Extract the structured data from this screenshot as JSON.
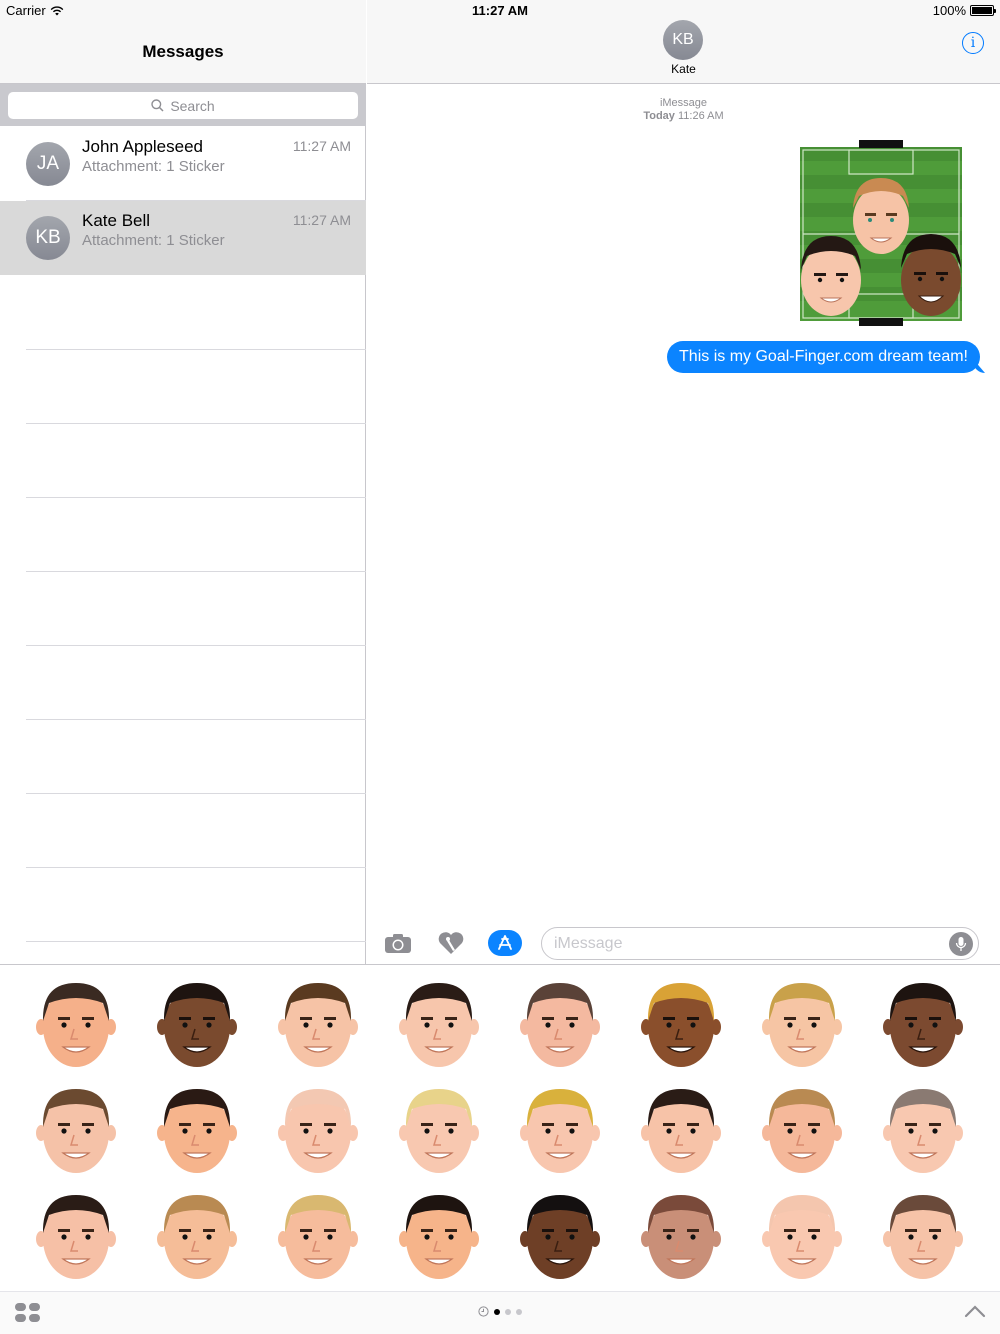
{
  "status_bar": {
    "carrier": "Carrier",
    "time": "11:27 AM",
    "battery": "100%"
  },
  "sidebar": {
    "title": "Messages",
    "search_placeholder": "Search",
    "conversations": [
      {
        "initials": "JA",
        "name": "John Appleseed",
        "preview": "Attachment: 1 Sticker",
        "time": "11:27 AM",
        "selected": false
      },
      {
        "initials": "KB",
        "name": "Kate Bell",
        "preview": "Attachment: 1 Sticker",
        "time": "11:27 AM",
        "selected": true
      }
    ]
  },
  "conversation": {
    "contact_initials": "KB",
    "contact_name": "Kate",
    "service": "iMessage",
    "day": "Today",
    "time": "11:26 AM",
    "message": "This is my Goal-Finger.com dream team!",
    "bubble_color": "#0b84ff",
    "composer_placeholder": "iMessage"
  },
  "sticker_drawer": {
    "rows": 3,
    "columns": 8,
    "skin_tones": [
      [
        "#f5b08a",
        "#7a4a2e",
        "#f6c3a6",
        "#f7c6ac",
        "#f4b9a0",
        "#8a4f2c",
        "#f6c5a4",
        "#7c4a30"
      ],
      [
        "#f5c2a8",
        "#f6b48c",
        "#f8c6ae",
        "#f8c8b0",
        "#f8c6ae",
        "#f7c3a8",
        "#f5b89a",
        "#f8c8b0"
      ],
      [
        "#f6c0a6",
        "#f5bd98",
        "#f6bc9c",
        "#f6b48a",
        "#6e3f26",
        "#c98f78",
        "#f9c8b0",
        "#f6c3a8"
      ]
    ],
    "hair_colors": [
      [
        "#3a2a22",
        "#1e1410",
        "#5a3a20",
        "#2a1c16",
        "#5a4238",
        "#d9a236",
        "#c9a14a",
        "#1e1410"
      ],
      [
        "#6b4a30",
        "#2a1a14",
        "#f3c8b2",
        "#e8d38a",
        "#d9b13c",
        "#2a1c16",
        "#b98a52",
        "#8a7a72"
      ],
      [
        "#2a1c16",
        "#b98a52",
        "#d9b870",
        "#1e1410",
        "#141010",
        "#7a4a3a",
        "#f4c6ae",
        "#6a4a3a"
      ]
    ],
    "page_dots": 3,
    "active_dot": 0
  },
  "colors": {
    "accent": "#007aff",
    "pitch": "#4e9b3a",
    "avatar_gray": "#8e8e93"
  }
}
